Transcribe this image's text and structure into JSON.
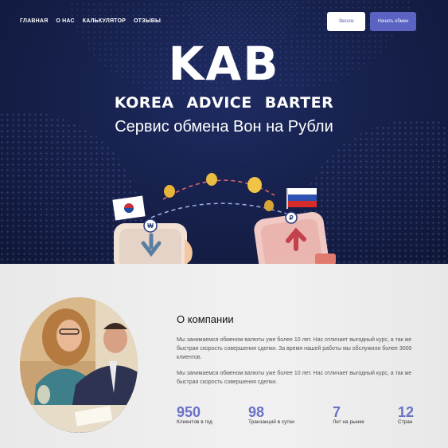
{
  "nav": {
    "items": [
      "ГЛАВНАЯ",
      "О НАС",
      "КАЛЬКУЛЯТОР",
      "ОТЗЫВЫ"
    ]
  },
  "header": {
    "call_label": "Звонок",
    "start_label": "Начать обмен"
  },
  "hero": {
    "logo": "KAB",
    "logo_words": [
      "KOREA",
      "ADVICE",
      "BARTER"
    ],
    "tagline": "Сервис обмена Вон на Рубли"
  },
  "about": {
    "title": "О компании",
    "paragraph1": "Мы занимаемся обменом валюты уже более 10 лет. Нас отличает выгодный курс, а так же быстрая скорость совершения сделки. За время нашей работы мы обслужили более 3000 клиентов.",
    "paragraph2": "Мы занимаемся обменом валюты уже более 10 лет. Нас отличает выгодный курс, а так же быстрая скорость совершения сделки.",
    "stats": [
      {
        "value": "950",
        "label": "Клиентов в год"
      },
      {
        "value": "98",
        "label": "Транзакций в сутки"
      },
      {
        "value": "7",
        "label": "Лет на рынке"
      },
      {
        "value": "12",
        "label": "Стран"
      }
    ]
  },
  "colors": {
    "hero_bg": "#17214d",
    "accent": "#5a62c2",
    "stat_number": "#6a72c8"
  }
}
